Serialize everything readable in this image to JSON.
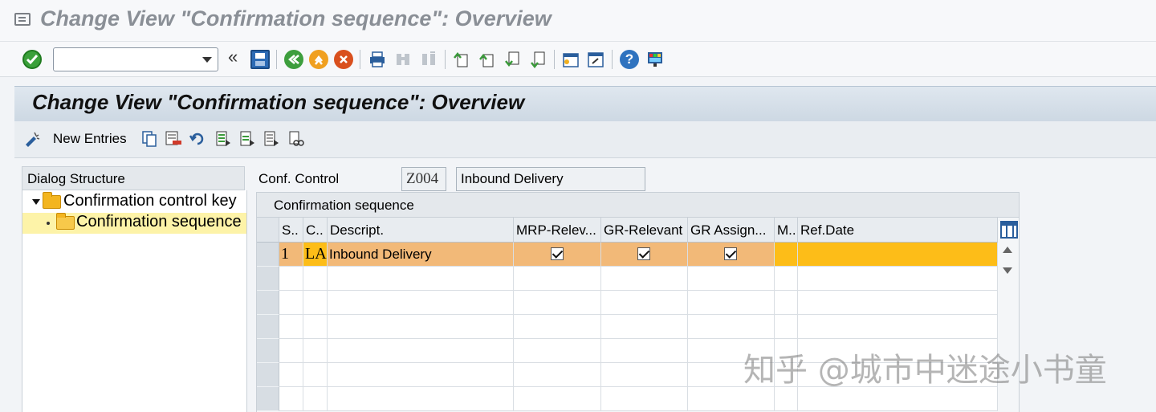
{
  "window": {
    "title": "Change View \"Confirmation sequence\": Overview"
  },
  "toolbar": {
    "command_field": {
      "value": "",
      "placeholder": ""
    },
    "chevron": "«"
  },
  "screen_header": {
    "title": "Change View \"Confirmation sequence\": Overview"
  },
  "app_toolbar": {
    "new_entries_label": "New Entries"
  },
  "dialog_structure": {
    "header": "Dialog Structure",
    "items": [
      {
        "label": "Confirmation control key"
      },
      {
        "label": "Confirmation sequence"
      }
    ]
  },
  "conf_control": {
    "label": "Conf. Control",
    "code": "Z004",
    "description": "Inbound Delivery"
  },
  "table": {
    "title": "Confirmation sequence",
    "columns": [
      "S..",
      "C..",
      "Descript.",
      "MRP-Relev...",
      "GR-Relevant",
      "GR Assign...",
      "M..",
      "Ref.Date"
    ],
    "rows": [
      {
        "seq": "1",
        "conf_cat": "LA",
        "description": "Inbound Delivery",
        "mrp_relevant": true,
        "gr_relevant": true,
        "gr_assignment": true,
        "m": "",
        "ref_date": ""
      }
    ]
  },
  "colors": {
    "selected_row": "#f2b978",
    "highlight_cell": "#fdbd18",
    "tree_selected": "#fdf3a8",
    "header_bg": "#cdd8e3"
  },
  "watermark": "知乎 @城市中迷途小书童"
}
